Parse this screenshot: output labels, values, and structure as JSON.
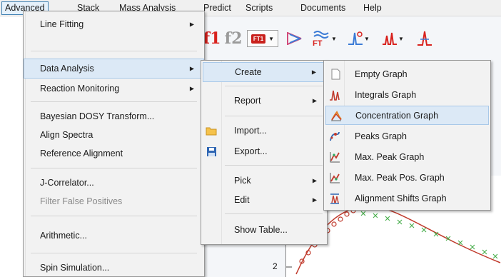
{
  "menubar": {
    "items": [
      {
        "label": "Advanced",
        "active": true
      },
      {
        "label": "Stack"
      },
      {
        "label": "Mass Analysis"
      },
      {
        "label": "Predict"
      },
      {
        "label": "Scripts"
      },
      {
        "label": "Documents"
      },
      {
        "label": "Help"
      }
    ]
  },
  "advanced_menu": {
    "line_fitting": "Line Fitting",
    "data_analysis": "Data Analysis",
    "reaction_monitoring": "Reaction Monitoring",
    "bayesian_dosy": "Bayesian DOSY Transform...",
    "align_spectra": "Align Spectra",
    "reference_alignment": "Reference Alignment",
    "j_correlator": "J-Correlator...",
    "filter_false_positives": "Filter False Positives",
    "arithmetic": "Arithmetic...",
    "spin_simulation": "Spin Simulation..."
  },
  "data_analysis_menu": {
    "create": "Create",
    "report": "Report",
    "import": "Import...",
    "export": "Export...",
    "pick": "Pick",
    "edit": "Edit",
    "show_table": "Show Table..."
  },
  "create_menu": {
    "items": [
      {
        "label": "Empty Graph",
        "icon": "empty-graph-icon"
      },
      {
        "label": "Integrals Graph",
        "icon": "integrals-graph-icon"
      },
      {
        "label": "Concentration Graph",
        "icon": "concentration-graph-icon"
      },
      {
        "label": "Peaks Graph",
        "icon": "peaks-graph-icon"
      },
      {
        "label": "Max. Peak Graph",
        "icon": "max-peak-graph-icon"
      },
      {
        "label": "Max. Peak Pos. Graph",
        "icon": "max-peak-pos-graph-icon"
      },
      {
        "label": "Alignment Shifts Graph",
        "icon": "alignment-shifts-graph-icon"
      }
    ]
  },
  "toolbar": {
    "f1": "f1",
    "f2": "f2",
    "ft1": "FT1",
    "ft": "FT"
  },
  "plot": {
    "y_tick": "2"
  },
  "colors": {
    "highlight": "#dce9f6",
    "f1_red": "#d8221e",
    "series_red": "#c0392b",
    "series_green": "#4caf50"
  }
}
